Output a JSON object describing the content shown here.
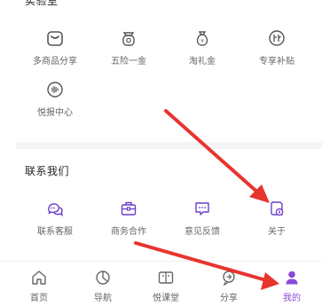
{
  "lab_section": {
    "title": "实验室",
    "items": [
      {
        "label": "多商品分享",
        "icon": "multi-product-share-icon"
      },
      {
        "label": "五险一金",
        "icon": "social-insurance-icon"
      },
      {
        "label": "淘礼金",
        "icon": "taolijin-bag-icon"
      },
      {
        "label": "专享补贴",
        "icon": "subsidy-icon"
      },
      {
        "label": "悦报中心",
        "icon": "report-center-icon"
      }
    ]
  },
  "contact_section": {
    "title": "联系我们",
    "items": [
      {
        "label": "联系客服",
        "icon": "customer-service-icon"
      },
      {
        "label": "商务合作",
        "icon": "business-cooperation-icon"
      },
      {
        "label": "意见反馈",
        "icon": "feedback-icon"
      },
      {
        "label": "关于",
        "icon": "about-icon"
      }
    ]
  },
  "tabbar": {
    "active_color": "#8a4bd8",
    "items": [
      {
        "label": "首页",
        "icon": "home-icon"
      },
      {
        "label": "导航",
        "icon": "navigation-icon"
      },
      {
        "label": "悦课堂",
        "icon": "classroom-icon"
      },
      {
        "label": "分享",
        "icon": "share-icon"
      },
      {
        "label": "我的",
        "icon": "profile-icon",
        "active": true
      }
    ]
  },
  "annotation_color": "#e8342e"
}
